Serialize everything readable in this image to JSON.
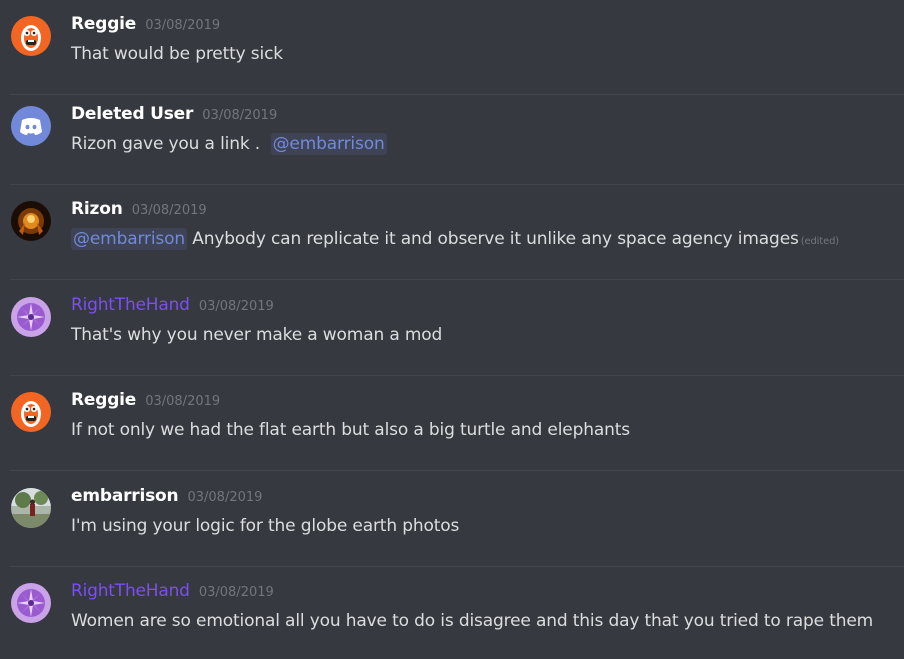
{
  "messages": [
    {
      "author": "Reggie",
      "timestamp": "03/08/2019",
      "avatar": "reggie-avatar",
      "pre": "That would be pretty sick",
      "mention": "",
      "post": "",
      "edited": ""
    },
    {
      "author": "Deleted User",
      "timestamp": "03/08/2019",
      "avatar": "discord-logo-avatar",
      "pre": "Rizon gave you a link .  ",
      "mention": "@embarrison",
      "post": "",
      "edited": ""
    },
    {
      "author": "Rizon",
      "timestamp": "03/08/2019",
      "avatar": "rizon-avatar",
      "pre": "",
      "mention": "@embarrison",
      "post": " Anybody can replicate it and observe it unlike any space agency images",
      "edited": "(edited)"
    },
    {
      "author": "RightTheHand",
      "timestamp": "03/08/2019",
      "avatar": "purple-flower-avatar",
      "pre": "That's why you never make a woman a mod",
      "mention": "",
      "post": "",
      "edited": ""
    },
    {
      "author": "Reggie",
      "timestamp": "03/08/2019",
      "avatar": "reggie-avatar",
      "pre": "If not only we had the flat earth but also a big turtle and elephants",
      "mention": "",
      "post": "",
      "edited": ""
    },
    {
      "author": "embarrison",
      "timestamp": "03/08/2019",
      "avatar": "embarrison-avatar",
      "pre": "I'm using your logic for the globe earth photos",
      "mention": "",
      "post": "",
      "edited": ""
    },
    {
      "author": "RightTheHand",
      "timestamp": "03/08/2019",
      "avatar": "purple-flower-avatar",
      "pre": "Women are so emotional all you have to do is disagree and this day that you tried to rape them",
      "mention": "",
      "post": "",
      "edited": ""
    }
  ],
  "colors": {
    "background": "#36393f",
    "username": "#ffffff",
    "username_role_purple": "#7b4ff2",
    "timestamp": "#72767d",
    "text": "#dcddde",
    "mention": "#7289da"
  }
}
